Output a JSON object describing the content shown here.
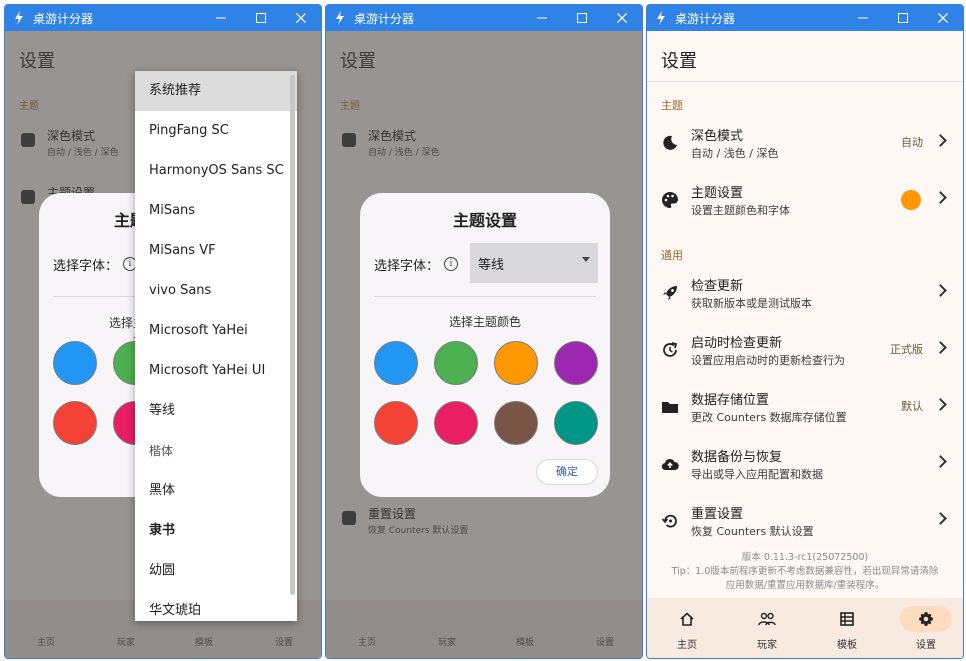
{
  "app": {
    "title": "桌游计分器"
  },
  "settings": {
    "title": "设置",
    "section_theme": "主题",
    "section_general": "通用",
    "rows": [
      {
        "icon": "moon-icon",
        "title": "深色模式",
        "subtitle": "自动 / 浅色 / 深色",
        "value": "自动"
      },
      {
        "icon": "palette-icon",
        "title": "主题设置",
        "subtitle": "设置主题颜色和字体",
        "value": ""
      },
      {
        "icon": "rocket-icon",
        "title": "检查更新",
        "subtitle": "获取新版本或是测试版本",
        "value": ""
      },
      {
        "icon": "refresh-clock-icon",
        "title": "启动时检查更新",
        "subtitle": "设置应用启动时的更新检查行为",
        "value": "正式版"
      },
      {
        "icon": "folder-icon",
        "title": "数据存储位置",
        "subtitle": "更改 Counters 数据库存储位置",
        "value": "默认"
      },
      {
        "icon": "cloud-upload-icon",
        "title": "数据备份与恢复",
        "subtitle": "导出或导入应用配置和数据",
        "value": ""
      },
      {
        "icon": "restore-icon",
        "title": "重置设置",
        "subtitle": "恢复 Counters 默认设置",
        "value": ""
      }
    ],
    "version": "版本 0.11.3-rc1(25072500)",
    "tip_line1": "Tip：1.0版本前程序更新不考虑数据兼容性，若出现异常请清除",
    "tip_line2": "应用数据/重置应用数据库/重装程序。",
    "theme_color": "#ff9800"
  },
  "nav": [
    {
      "icon": "home-icon",
      "label": "主页"
    },
    {
      "icon": "players-icon",
      "label": "玩家"
    },
    {
      "icon": "template-icon",
      "label": "模板"
    },
    {
      "icon": "gear-icon",
      "label": "设置"
    }
  ],
  "dialog": {
    "title": "主题设置",
    "font_label": "选择字体：",
    "font_value": "等线",
    "color_label": "选择主题颜色",
    "ok": "确定",
    "colors": [
      "#2196f3",
      "#4caf50",
      "#ff9800",
      "#9c27b0",
      "#f44336",
      "#e91e63",
      "#795548",
      "#009688"
    ]
  },
  "font_menu": {
    "options": [
      "系统推荐",
      "PingFang SC",
      "HarmonyOS Sans SC",
      "MiSans",
      "MiSans VF",
      "vivo Sans",
      "Microsoft YaHei",
      "Microsoft YaHei UI",
      "等线",
      "楷体",
      "黑体",
      "隶书",
      "幼圆",
      "华文琥珀"
    ]
  }
}
